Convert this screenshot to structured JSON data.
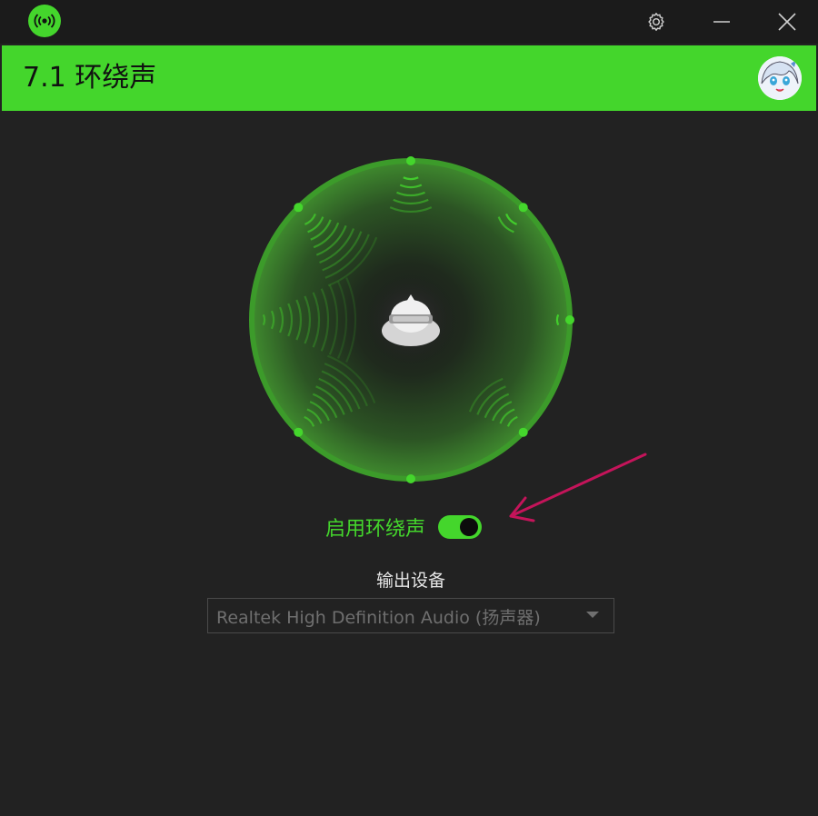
{
  "header": {
    "title": "7.1 环绕声"
  },
  "icons": {
    "app": "broadcast-icon",
    "settings": "gear-icon",
    "minimize": "minimize-icon",
    "close": "close-icon",
    "avatar": "user-avatar"
  },
  "visualizer": {
    "speaker_points": 8
  },
  "surround": {
    "toggle_label": "启用环绕声",
    "enabled": true
  },
  "output": {
    "label": "输出设备",
    "selected_device": "Realtek High Definition Audio (扬声器)"
  },
  "colors": {
    "accent": "#44d62c",
    "background": "#222222",
    "titlebar": "#1b1b1b",
    "annotation": "#c4145a"
  }
}
